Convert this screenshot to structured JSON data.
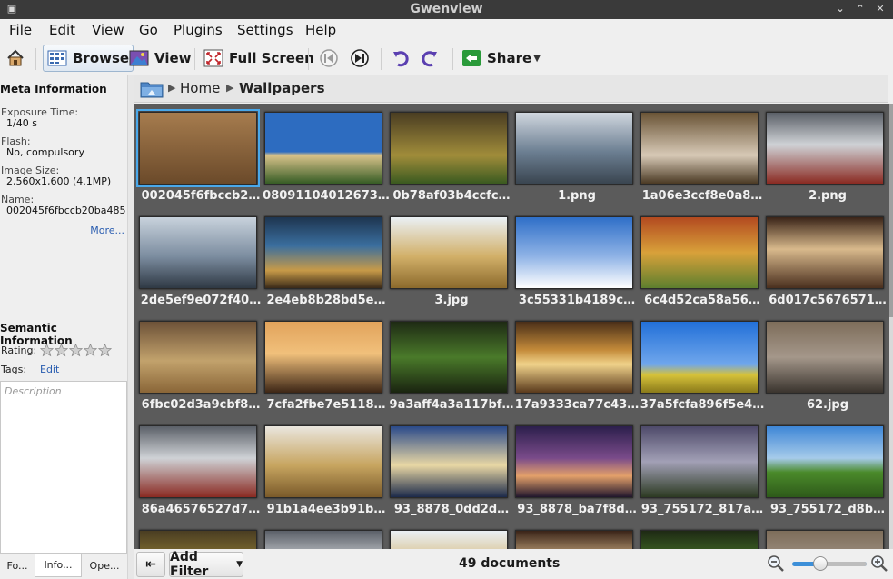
{
  "window": {
    "title": "Gwenview"
  },
  "menu": [
    "File",
    "Edit",
    "View",
    "Go",
    "Plugins",
    "Settings",
    "Help"
  ],
  "toolbar": {
    "browse": "Browse",
    "view": "View",
    "fullscreen": "Full Screen",
    "share": "Share"
  },
  "sidebar": {
    "meta_header": "Meta Information",
    "fields": [
      {
        "label": "Exposure Time:",
        "value": "1/40 s"
      },
      {
        "label": "Flash:",
        "value": "No, compulsory"
      },
      {
        "label": "Image Size:",
        "value": "2,560x1,600 (4.1MP)"
      },
      {
        "label": "Name:",
        "value": "002045f6fbccb20ba485"
      }
    ],
    "more": "More...",
    "semantic_header": "Semantic Information",
    "rating_label": "Rating:",
    "rating": 0,
    "tags_label": "Tags:",
    "tags_edit": "Edit",
    "description_placeholder": "Description",
    "tabs": [
      "Fo...",
      "Info...",
      "Ope..."
    ],
    "active_tab": "Info..."
  },
  "breadcrumb": [
    "Home",
    "Wallpapers"
  ],
  "thumbnails": [
    "002045f6fbccb2…",
    "08091104012673…",
    "0b78af03b4ccfc…",
    "1.png",
    "1a06e3ccf8e0a8…",
    "2.png",
    "2de5ef9e072f40…",
    "2e4eb8b28bd5e…",
    "3.jpg",
    "3c55331b4189c…",
    "6c4d52ca58a56…",
    "6d017c5676571…",
    "6fbc02d3a9cbf8…",
    "7cfa2fbe7e5118…",
    "9a3aff4a3a117bf…",
    "17a9333ca77c43…",
    "37a5fcfa896f5e4…",
    "62.jpg",
    "86a46576527d7…",
    "91b1a4ee3b91b…",
    "93_8878_0dd2d…",
    "93_8878_ba7f8d…",
    "93_755172_817a…",
    "93_755172_d8b…"
  ],
  "selected_thumbnail": "002045f6fbccb2…",
  "statusbar": {
    "add_filter": "Add Filter",
    "count": "49 documents",
    "zoom_level": 0.35
  },
  "colors": {
    "accent": "#49a8ea",
    "link": "#2a5db0",
    "thumb_bg": "#5b5b5b"
  }
}
